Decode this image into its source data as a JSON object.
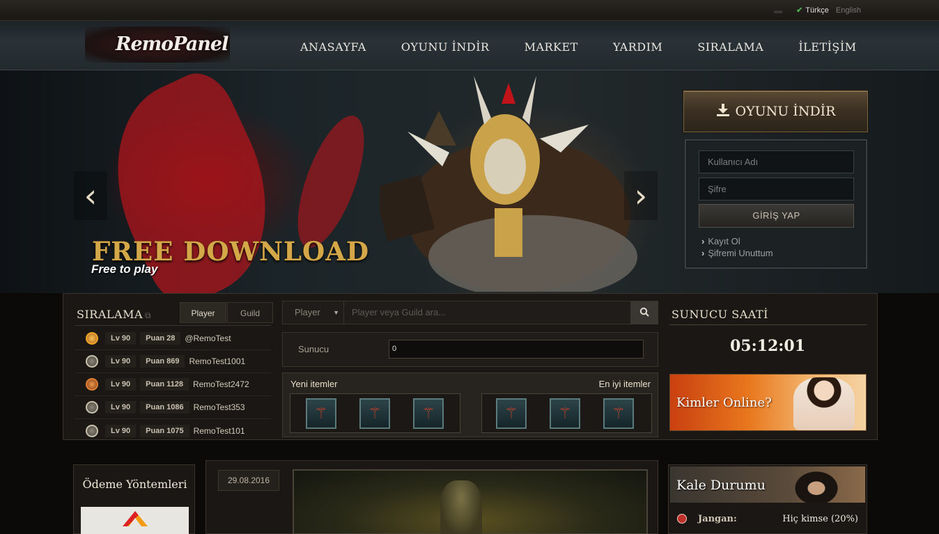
{
  "colors": {
    "accent_gold": "#d4a848",
    "panel_bg": "#1a1714",
    "active_check": "#4caf50"
  },
  "languages": [
    {
      "label": "Türkçe",
      "active": true
    },
    {
      "label": "English",
      "active": false
    }
  ],
  "header": {
    "logo_text": "RemoPanel",
    "nav": [
      "ANASAYFA",
      "OYUNU İNDİR",
      "MARKET",
      "YARDIM",
      "SIRALAMA",
      "İLETİŞİM"
    ]
  },
  "hero": {
    "title": "FREE DOWNLOAD",
    "subtitle": "Free to play",
    "prev_icon": "chevron-left-icon",
    "next_icon": "chevron-right-icon"
  },
  "account": {
    "download_label": "OYUNU İNDİR",
    "download_icon": "download-icon",
    "username_placeholder": "Kullanıcı Adı",
    "password_placeholder": "Şifre",
    "login_label": "GİRİŞ YAP",
    "register_label": "Kayıt Ol",
    "forgot_label": "Şifremi Unuttum"
  },
  "ranking": {
    "title": "SIRALAMA",
    "tabs": [
      "Player",
      "Guild"
    ],
    "active_tab": "Player",
    "rows": [
      {
        "lv": "Lv 90",
        "puan": "Puan 28",
        "name": "@RemoTest",
        "icon": "gold"
      },
      {
        "lv": "Lv 90",
        "puan": "Puan 869",
        "name": "RemoTest1001",
        "icon": "silver"
      },
      {
        "lv": "Lv 90",
        "puan": "Puan 1128",
        "name": "RemoTest2472",
        "icon": "red"
      },
      {
        "lv": "Lv 90",
        "puan": "Puan 1086",
        "name": "RemoTest353",
        "icon": "silver"
      },
      {
        "lv": "Lv 90",
        "puan": "Puan 1075",
        "name": "RemoTest101",
        "icon": "silver"
      }
    ]
  },
  "search": {
    "type_selected": "Player",
    "placeholder": "Player veya Guild ara..."
  },
  "server": {
    "label": "Sunucu",
    "value": "0"
  },
  "items": {
    "new_label": "Yeni itemler",
    "best_label": "En iyi itemler",
    "new_count": 3,
    "best_count": 3
  },
  "clock": {
    "title": "SUNUCU SAATİ",
    "time": "05:12:01"
  },
  "online_banner": "Kimler Online?",
  "payment": {
    "title": "Ödeme Yöntemleri"
  },
  "news": {
    "date": "29.08.2016"
  },
  "castle": {
    "title": "Kale Durumu",
    "rows": [
      {
        "name": "Jangan:",
        "value": "Hiç kimse (20%)"
      }
    ]
  }
}
